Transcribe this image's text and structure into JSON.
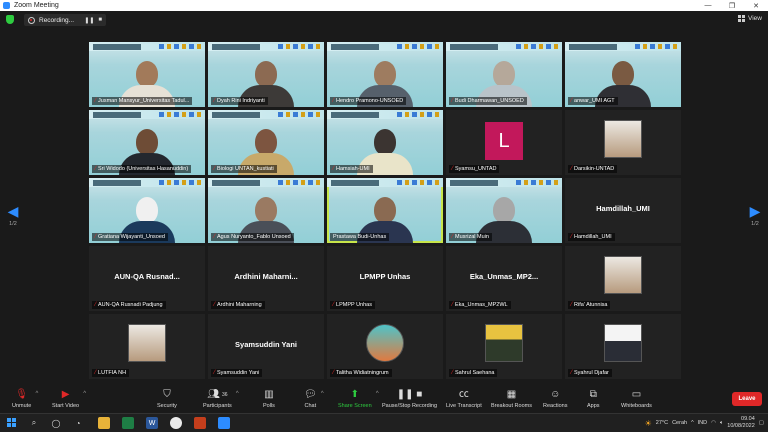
{
  "window": {
    "title": "Zoom Meeting",
    "controls": [
      "—",
      "❐",
      "✕"
    ]
  },
  "recording": {
    "label": "Recording...",
    "pause": "❚❚",
    "stop": "■"
  },
  "view": {
    "label": "View"
  },
  "pager": {
    "left_count": "1/2",
    "right_count": "1/2"
  },
  "tiles": [
    {
      "type": "video",
      "name": "Jusman Mansyur_Universitas Tadul...",
      "muted": true,
      "head": "#a27a5a",
      "shirt": "#e6e1d6"
    },
    {
      "type": "video",
      "name": "Dyah Rini Indriyanti",
      "muted": true,
      "head": "#8c6a52",
      "shirt": "#3d3a38"
    },
    {
      "type": "video",
      "name": "Hendro Pramono-UNSOED",
      "muted": true,
      "head": "#9e7c60",
      "shirt": "#56606b"
    },
    {
      "type": "video",
      "name": "Budi Dharmawan_UNSOED",
      "muted": true,
      "head": "#b5a89a",
      "shirt": "#b9c3c9"
    },
    {
      "type": "video",
      "name": "anwar_UMI AGT",
      "muted": true,
      "head": "#7a5a42",
      "shirt": "#2f2f34"
    },
    {
      "type": "video",
      "name": "Sri Widodo (Universitas Hasanuddin)",
      "muted": true,
      "head": "#6e4c36",
      "shirt": "#23272e"
    },
    {
      "type": "video",
      "name": "Biologi UNTAN_kustiati",
      "muted": true,
      "head": "#7d5540",
      "shirt": "#c8a96a"
    },
    {
      "type": "video",
      "name": "Hamsiah-UMI",
      "muted": true,
      "head": "#3b3431",
      "shirt": "#e9e4c9"
    },
    {
      "type": "letter",
      "name": "Syamsu_UNTAD",
      "muted": true,
      "letter": "L"
    },
    {
      "type": "photo",
      "name": "Darsikin-UNTAD",
      "muted": true,
      "variant": "light"
    },
    {
      "type": "video",
      "name": "Gratiana Wijayanti_Unsoed",
      "muted": true,
      "head": "#f0f0f0",
      "shirt": "#1b3a5c"
    },
    {
      "type": "video",
      "name": "Agus Nuryanto_Fablo Unsoed",
      "muted": true,
      "head": "#9a7a62",
      "shirt": "#4a4f58"
    },
    {
      "type": "video",
      "name": "Prastawa Budi-Unhas",
      "muted": false,
      "active": true,
      "head": "#8a6a52",
      "shirt": "#2a3550"
    },
    {
      "type": "video",
      "name": "Musrizal Muin",
      "muted": true,
      "head": "#a7a7a7",
      "shirt": "#2c2f36"
    },
    {
      "type": "text",
      "name": "Hamdillah_UMI",
      "muted": true,
      "display": "Hamdillah_UMI"
    },
    {
      "type": "text",
      "name": "AUN-QA Rusnadi Padjung",
      "muted": true,
      "display": "AUN-QA  Rusnad..."
    },
    {
      "type": "text",
      "name": "Ardhini Maharning",
      "muted": true,
      "display": "Ardhini  Maharni..."
    },
    {
      "type": "text",
      "name": "LPMPP Unhas",
      "muted": true,
      "display": "LPMPP Unhas"
    },
    {
      "type": "text",
      "name": "Eka_Unmas_MP2WL",
      "muted": true,
      "display": "Eka_Unmas_MP2..."
    },
    {
      "type": "photo",
      "name": "Rifa' Atunnisa",
      "muted": true,
      "variant": "light"
    },
    {
      "type": "photo",
      "name": "LUTFIA NH",
      "muted": true,
      "variant": "light"
    },
    {
      "type": "text",
      "name": "Syamsuddin Yani",
      "muted": true,
      "display": "Syamsuddin Yani"
    },
    {
      "type": "photo",
      "name": "Talitha Widiatningrum",
      "muted": true,
      "variant": "teal"
    },
    {
      "type": "photo",
      "name": "Sahrul Saehana",
      "muted": true,
      "variant": "poster"
    },
    {
      "type": "photo",
      "name": "Syahrul Djafar",
      "muted": true,
      "variant": "suit"
    }
  ],
  "toolbar": {
    "unmute": "Unmute",
    "stop_video": "Start Video",
    "security": "Security",
    "participants": "Participants",
    "participants_count": "36",
    "polls": "Polls",
    "chat": "Chat",
    "share_screen": "Share Screen",
    "pause_recording": "Pause/Stop Recording",
    "live_transcript": "Live Transcript",
    "breakout_rooms": "Breakout Rooms",
    "reactions": "Reactions",
    "apps": "Apps",
    "whiteboards": "Whiteboards",
    "leave": "Leave"
  },
  "taskbar": {
    "weather_temp": "27°C",
    "weather_desc": "Cerah",
    "language": "IND",
    "time": "09.04",
    "date": "10/08/2022"
  }
}
